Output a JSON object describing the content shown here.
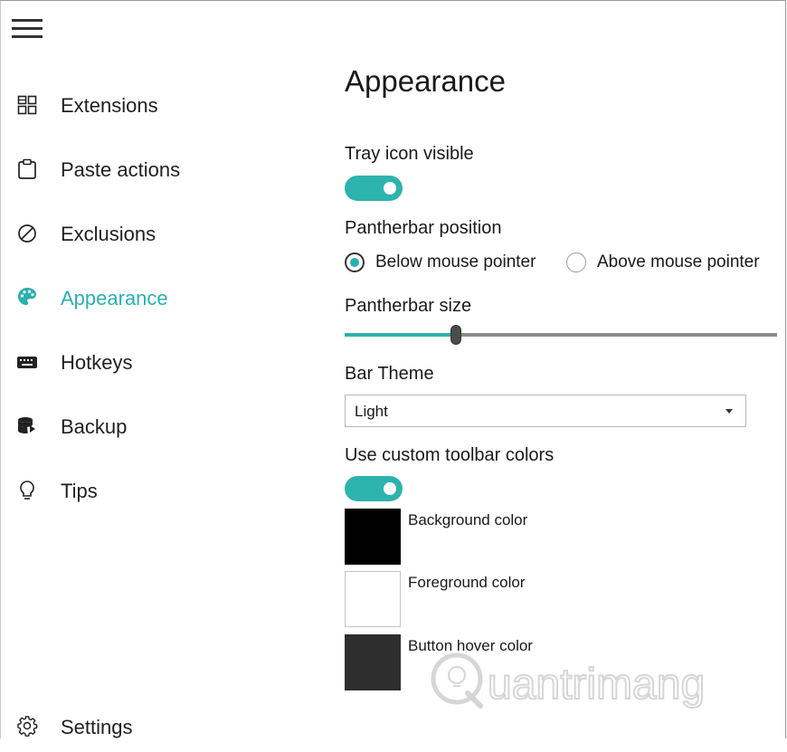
{
  "sidebar": {
    "menu_icon": "hamburger-menu-icon",
    "items": [
      {
        "label": "Extensions",
        "icon": "extensions-grid-icon"
      },
      {
        "label": "Paste actions",
        "icon": "clipboard-icon"
      },
      {
        "label": "Exclusions",
        "icon": "prohibited-icon"
      },
      {
        "label": "Appearance",
        "icon": "palette-icon",
        "active": true
      },
      {
        "label": "Hotkeys",
        "icon": "keyboard-icon"
      },
      {
        "label": "Backup",
        "icon": "database-backup-icon"
      },
      {
        "label": "Tips",
        "icon": "lightbulb-icon"
      }
    ],
    "settings": {
      "label": "Settings",
      "icon": "gear-icon"
    }
  },
  "main": {
    "title": "Appearance",
    "tray_icon": {
      "label": "Tray icon visible",
      "on": true
    },
    "position": {
      "label": "Pantherbar position",
      "options": [
        {
          "label": "Below mouse pointer",
          "checked": true
        },
        {
          "label": "Above mouse pointer",
          "checked": false
        }
      ]
    },
    "size": {
      "label": "Pantherbar size",
      "value_fraction": 0.26
    },
    "theme": {
      "label": "Bar Theme",
      "selected": "Light"
    },
    "custom_colors": {
      "label": "Use custom toolbar colors",
      "on": true
    },
    "colors": [
      {
        "label": "Background color",
        "value": "#000000"
      },
      {
        "label": "Foreground color",
        "value": "#ffffff"
      },
      {
        "label": "Button hover color",
        "value": "#2e2e2e"
      }
    ]
  },
  "watermark": {
    "text": "uantrimang"
  },
  "accent_color": "#2bb0b0"
}
